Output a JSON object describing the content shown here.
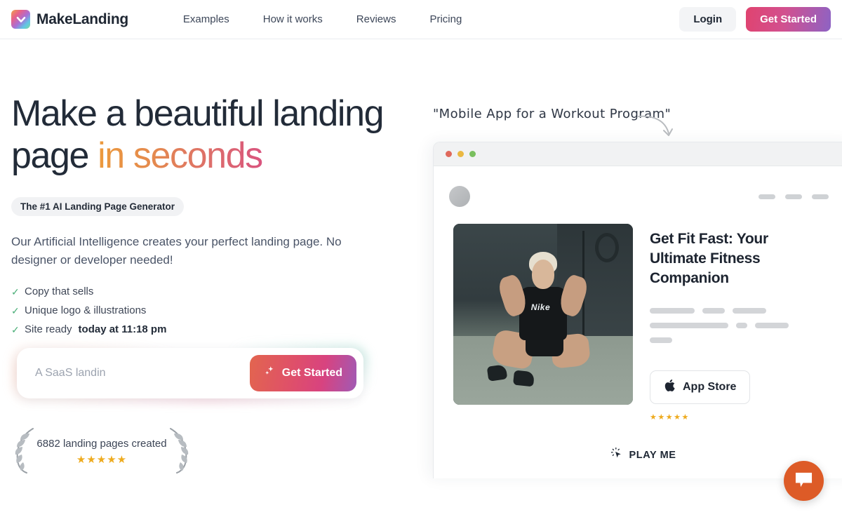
{
  "header": {
    "brand": "MakeLanding",
    "logo_icon": "chevron-down-logo-icon",
    "nav": [
      {
        "label": "Examples"
      },
      {
        "label": "How it works"
      },
      {
        "label": "Reviews"
      },
      {
        "label": "Pricing"
      }
    ],
    "login_label": "Login",
    "get_started_label": "Get Started"
  },
  "hero": {
    "headline_part1": "Make a beautiful landing page ",
    "headline_accent": "in seconds",
    "badge": "The #1 AI Landing Page Generator",
    "lede": "Our Artificial Intelligence creates your perfect landing page. No designer or developer needed!",
    "checks": [
      {
        "mark": "✓",
        "text": "Copy that sells",
        "bold": ""
      },
      {
        "mark": "✓",
        "text": "Unique logo & illustrations",
        "bold": ""
      },
      {
        "mark": "✓",
        "text": "Site ready ",
        "bold": "today at 11:18 pm"
      }
    ],
    "input_placeholder": "A SaaS landin",
    "input_value": "",
    "cta_label": "Get Started",
    "cta_icon": "sparkles-icon"
  },
  "social_proof": {
    "count_text": "6882 landing pages created",
    "stars": "★★★★★",
    "star_color": "#eeab1f",
    "left_icon": "laurel-left-icon",
    "right_icon": "laurel-right-icon"
  },
  "annotation": {
    "text": "\"Mobile App for a Workout Program\"",
    "arrow_icon": "curved-arrow-icon"
  },
  "mockup": {
    "window_dots": [
      {
        "name": "close-dot",
        "color": "#e0695c"
      },
      {
        "name": "minimize-dot",
        "color": "#eab842"
      },
      {
        "name": "maximize-dot",
        "color": "#79bf5e"
      }
    ],
    "avatar_icon": "logo-placeholder-circle",
    "nav_pill_widths": [
      24,
      24,
      24
    ],
    "photo_alt": "woman doing sit-ups in a gym",
    "photo_brand_text": "Nike",
    "title": "Get Fit Fast: Your Ultimate Fitness Companion",
    "skeleton_rows": [
      [
        64,
        32,
        48
      ],
      [
        112,
        16,
        48
      ],
      [
        32
      ]
    ],
    "store_button_label": "App Store",
    "store_button_icon": "apple-icon",
    "store_stars": "★★★★★",
    "play_me_label": "PLAY ME",
    "play_me_icon": "click-cursor-icon"
  },
  "chat": {
    "icon": "chat-bubble-icon",
    "color": "#dd5b27"
  }
}
